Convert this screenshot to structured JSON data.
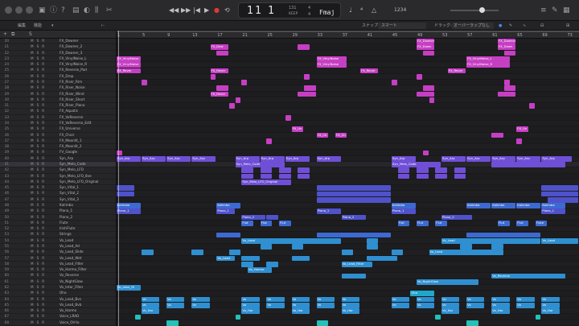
{
  "colors": {
    "fx": "#c63fc3",
    "synth": "#6f4fd6",
    "piano": "#4f52c9",
    "keys": "#3c6ad2",
    "vocal": "#2f8fd0",
    "vox2": "#1fa7c9",
    "cyan": "#23c1b7"
  },
  "transport": {
    "bar": "1",
    "beat": "1",
    "div": "1",
    "tempo": "131",
    "tempo_label": "KEEP",
    "sig_top": "4",
    "sig_bottom": "4",
    "key": "Fmaj",
    "counter": "1234"
  },
  "toolbar": {
    "edit": "編集",
    "functions": "機能",
    "snap_label": "スナップ:",
    "snap_value": "スマート",
    "drag_label": "ドラッグ:",
    "drag_value": "オーバーラップなし"
  },
  "ruler": [
    "1",
    "5",
    "9",
    "13",
    "17",
    "21",
    "25",
    "29",
    "33",
    "37",
    "41",
    "45",
    "49",
    "53",
    "57",
    "61",
    "65",
    "69",
    "73"
  ],
  "tracks": [
    {
      "num": "20",
      "name": "FX_Downer"
    },
    {
      "num": "21",
      "name": "FX_Downer_2"
    },
    {
      "num": "22",
      "name": "FX_Downer_3"
    },
    {
      "num": "23",
      "name": "FX_VinylNoise_L"
    },
    {
      "num": "24",
      "name": "FX_VinylNoise_R"
    },
    {
      "num": "25",
      "name": "FX_Reverse_Pad"
    },
    {
      "num": "26",
      "name": "FX_Drop"
    },
    {
      "num": "27",
      "name": "FX_Riser_Rim"
    },
    {
      "num": "28",
      "name": "FX_Riser_Noise"
    },
    {
      "num": "29",
      "name": "FX_Riser_Wind"
    },
    {
      "num": "30",
      "name": "FX_Riser_Short"
    },
    {
      "num": "31",
      "name": "FX_Riser_Piano"
    },
    {
      "num": "32",
      "name": "FX_Aquatic"
    },
    {
      "num": "33",
      "name": "FX_VoReverse"
    },
    {
      "num": "34",
      "name": "FX_VoReverse_Edit"
    },
    {
      "num": "35",
      "name": "FX_Universe"
    },
    {
      "num": "36",
      "name": "FX_Choir"
    },
    {
      "num": "37",
      "name": "FX_Moonlit_1"
    },
    {
      "num": "38",
      "name": "FX_Moonlit_2"
    },
    {
      "num": "39",
      "name": "FV_Google"
    },
    {
      "num": "40",
      "name": "Syn_Arp"
    },
    {
      "num": "41",
      "name": "Syn_Melo_Code"
    },
    {
      "num": "42",
      "name": "Syn_Melo_LFO"
    },
    {
      "num": "43",
      "name": "Syn_Melo_LFO_8ve"
    },
    {
      "num": "44",
      "name": "Syn_Melo_LFO_Original"
    },
    {
      "num": "45",
      "name": "Syn_Vital_1"
    },
    {
      "num": "46",
      "name": "Syn_Vital_2"
    },
    {
      "num": "47",
      "name": "Syn_Vital_3"
    },
    {
      "num": "48",
      "name": "Kalimba"
    },
    {
      "num": "49",
      "name": "Piano_1"
    },
    {
      "num": "50",
      "name": "Piano_2"
    },
    {
      "num": "51",
      "name": "Flute"
    },
    {
      "num": "52",
      "name": "IrishFlute"
    },
    {
      "num": "53",
      "name": "Strings"
    },
    {
      "num": "54",
      "name": "Vo_Lead"
    },
    {
      "num": "55",
      "name": "Vo_Lead_Ad"
    },
    {
      "num": "56",
      "name": "Vo_Lead_Slide"
    },
    {
      "num": "57",
      "name": "Vo_Lead_Wet"
    },
    {
      "num": "58",
      "name": "Vo_Lead_Filter"
    },
    {
      "num": "59",
      "name": "Vo_Harmo_Filter"
    },
    {
      "num": "60",
      "name": "Vo_Reverse"
    },
    {
      "num": "61",
      "name": "Vo_NightGlow"
    },
    {
      "num": "62",
      "name": "Vo_Intor_Filter"
    },
    {
      "num": "63",
      "name": "Oho"
    },
    {
      "num": "64",
      "name": "Vo_Lead_Bvs"
    },
    {
      "num": "65",
      "name": "Vo_Lead_Bvb"
    },
    {
      "num": "66",
      "name": "Vo_Harmo"
    },
    {
      "num": "67",
      "name": "Voice_LRAD"
    },
    {
      "num": "68",
      "name": "Voice_Oh!lo"
    }
  ],
  "region_labels": {
    "fx_dow": "FX_Dow",
    "fx_downer": "FX_Downer",
    "fx_down": "FX_Down",
    "fx_vinyl": "FX_VinylNoise",
    "fx_vinyl_l": "FX_VinylNoise_L",
    "fx_vinyl_r": "FX_VinylNoise_R",
    "fx_rever": "FX_Rever",
    "fx_un": "FX_Un",
    "fx_ch": "FX_Ch",
    "syn_arp": "Syn_Arp",
    "syn_melo_code": "Syn_Melo_Code",
    "syn_melo_lfo_orig": "Syn_Melo_LFO_Original",
    "kalimba": "Kalimba",
    "piano_1": "Piano_1",
    "piano_2": "Piano_2",
    "flut": "Flut",
    "flute": "Flute",
    "vo_lead": "Vo_Lead",
    "vo_lead_filter": "Vo_Lead_Filter",
    "vo_harmo": "Vo_Harmo",
    "vo_reverse": "Vo_Reverse",
    "vo_nightglow": "Vo_NightGlow",
    "vo_intor": "Vo_Intor_Fil",
    "oho": "Oho",
    "vo_har": "Vo_Har",
    "vo": "Vo"
  }
}
